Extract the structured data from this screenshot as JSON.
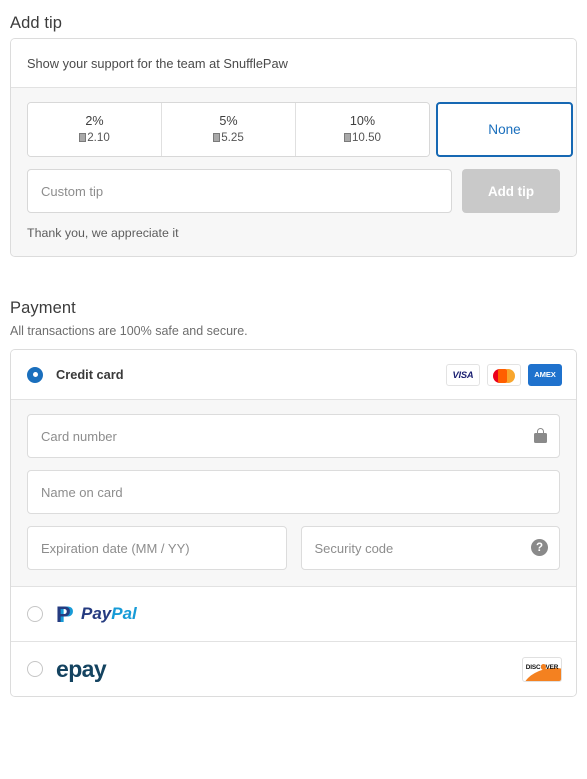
{
  "tip": {
    "title": "Add tip",
    "header_text": "Show your support for the team at SnufflePaw",
    "options": [
      {
        "percent": "2%",
        "amount": "2.10",
        "selected": false
      },
      {
        "percent": "5%",
        "amount": "5.25",
        "selected": false
      },
      {
        "percent": "10%",
        "amount": "10.50",
        "selected": false
      }
    ],
    "none_label": "None",
    "custom_placeholder": "Custom tip",
    "custom_value": "",
    "add_tip_label": "Add tip",
    "thanks_text": "Thank you, we appreciate it",
    "selected_color": "#1a6fbd",
    "disabled_button_color": "#c9c9c9"
  },
  "payment": {
    "title": "Payment",
    "subtitle": "All transactions are 100% safe and secure.",
    "methods": [
      {
        "id": "credit-card",
        "label": "Credit card",
        "selected": true,
        "brands": [
          "visa",
          "mastercard",
          "amex"
        ]
      },
      {
        "id": "paypal",
        "label": "PayPal",
        "selected": false,
        "logo_parts": {
          "first": "Pay",
          "second": "Pal",
          "mark": "P"
        }
      },
      {
        "id": "epay",
        "label": "epay",
        "selected": false,
        "brands": [
          "discover"
        ]
      }
    ],
    "brand_labels": {
      "visa": "VISA",
      "amex": "AMEX",
      "discover": "DISCOVER"
    },
    "fields": {
      "card_number": {
        "placeholder": "Card number",
        "value": "",
        "icon": "lock-icon"
      },
      "name_on_card": {
        "placeholder": "Name on card",
        "value": ""
      },
      "expiration": {
        "placeholder": "Expiration date (MM / YY)",
        "value": ""
      },
      "security_code": {
        "placeholder": "Security code",
        "value": "",
        "icon": "help-icon"
      }
    },
    "help_glyph": "?",
    "accent_color": "#1a6fbd"
  }
}
